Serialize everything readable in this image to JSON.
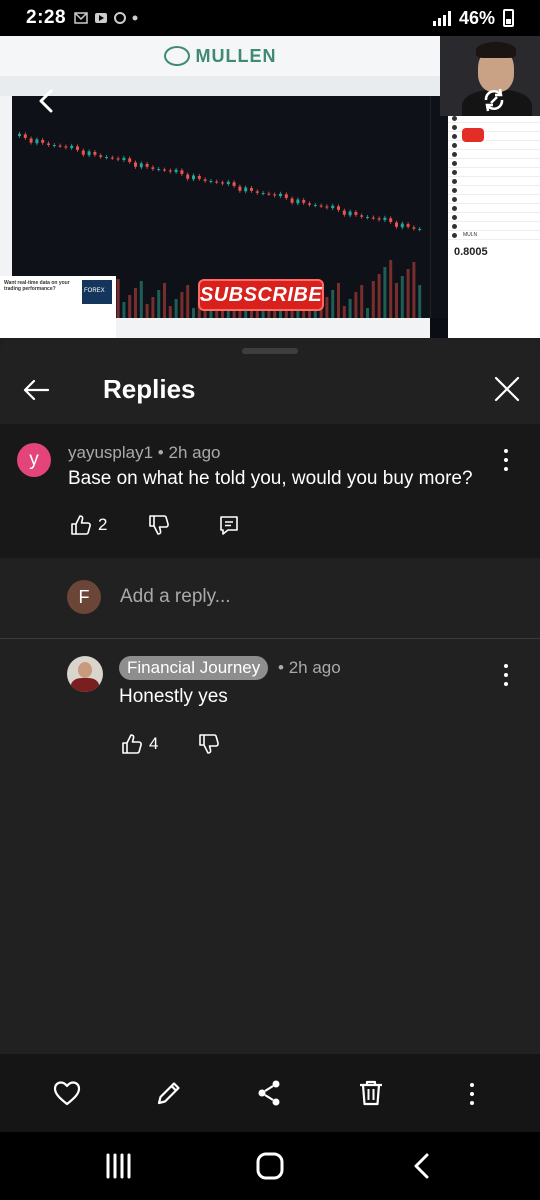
{
  "status_bar": {
    "time": "2:28",
    "battery": "46%"
  },
  "video": {
    "brand": "MULLEN",
    "ticker": "MULN",
    "price": "0.8005",
    "subscribe_label": "SUBSCRIBE",
    "ad_title": "Want real-time data on your trading performance?",
    "ad_brand": "FOREX"
  },
  "panel": {
    "title": "Replies"
  },
  "parent_comment": {
    "avatar_letter": "y",
    "avatar_color": "#e3457b",
    "author": "yayusplay1",
    "time": "2h ago",
    "text": "Base on what he told you, would you buy more?",
    "likes": "2"
  },
  "reply_input": {
    "avatar_letter": "F",
    "placeholder": "Add a reply..."
  },
  "replies": [
    {
      "author": "Financial Journey",
      "time": "2h ago",
      "text": "Honestly yes",
      "likes": "4"
    }
  ],
  "icons": {
    "back": "arrow-left-icon",
    "close": "close-icon",
    "like": "thumbs-up-icon",
    "dislike": "thumbs-down-icon",
    "reply": "reply-icon",
    "more": "more-vertical-icon",
    "heart": "heart-icon",
    "edit": "pencil-icon",
    "share": "share-icon",
    "delete": "trash-icon"
  }
}
